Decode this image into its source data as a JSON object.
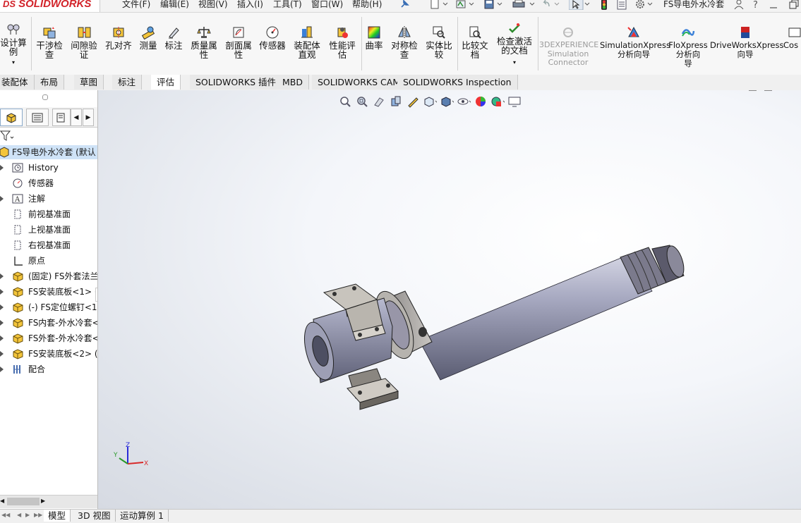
{
  "app": {
    "logo_prefix": "DS",
    "logo_text": "SOLIDWORKS",
    "doc_title": "FS导电外水冷套"
  },
  "menu": {
    "items": [
      "文件(F)",
      "编辑(E)",
      "视图(V)",
      "插入(I)",
      "工具(T)",
      "窗口(W)",
      "帮助(H)"
    ]
  },
  "command_manager": {
    "items": [
      {
        "label1": "设计算",
        "label2": "例"
      },
      {
        "label1": "干涉检",
        "label2": "查"
      },
      {
        "label1": "间隙验",
        "label2": "证"
      },
      {
        "label1": "孔对齐",
        "label2": ""
      },
      {
        "label1": "测量",
        "label2": ""
      },
      {
        "label1": "标注",
        "label2": ""
      },
      {
        "label1": "质量属",
        "label2": "性"
      },
      {
        "label1": "剖面属",
        "label2": "性"
      },
      {
        "label1": "传感器",
        "label2": ""
      },
      {
        "label1": "装配体",
        "label2": "直观"
      },
      {
        "label1": "性能评",
        "label2": "估"
      },
      {
        "label1": "曲率",
        "label2": ""
      },
      {
        "label1": "对称检",
        "label2": "查"
      },
      {
        "label1": "实体比",
        "label2": "较"
      },
      {
        "label1": "比较文",
        "label2": "档"
      },
      {
        "label1": "检查激活",
        "label2": "的文档"
      }
    ],
    "dim_item": {
      "label1": "3DEXPERIENCE",
      "label2": "Simulation",
      "label3": "Connector"
    },
    "addins": [
      {
        "label1": "SimulationXpress",
        "label2": "分析向导",
        "label3": ""
      },
      {
        "label1": "FloXpress",
        "label2": "分析向",
        "label3": "导"
      },
      {
        "label1": "DriveWorksXpress",
        "label2": "向导",
        "label3": ""
      },
      {
        "label1": "Cos",
        "label2": "",
        "label3": ""
      }
    ]
  },
  "tabs": [
    "装配体",
    "布局",
    "草图",
    "标注",
    "评估",
    "SOLIDWORKS 插件",
    "MBD",
    "SOLIDWORKS CAM",
    "SOLIDWORKS Inspection"
  ],
  "active_tab": "评估",
  "feature_tree": {
    "root": "FS导电外水冷套  (默认",
    "items": [
      {
        "label": "History",
        "icon": "history-icon",
        "expandable": true
      },
      {
        "label": "传感器",
        "icon": "sensor-icon",
        "expandable": false
      },
      {
        "label": "注解",
        "icon": "annotation-icon",
        "expandable": true
      },
      {
        "label": "前视基准面",
        "icon": "plane-icon",
        "expandable": false
      },
      {
        "label": "上视基准面",
        "icon": "plane-icon",
        "expandable": false
      },
      {
        "label": "右视基准面",
        "icon": "plane-icon",
        "expandable": false
      },
      {
        "label": "原点",
        "icon": "origin-icon",
        "expandable": false
      },
      {
        "label": "(固定) FS外套法兰",
        "icon": "part-icon",
        "expandable": true
      },
      {
        "label": "FS安装底板<1> (",
        "icon": "part-icon",
        "expandable": true
      },
      {
        "label": "(-) FS定位螺钉<1",
        "icon": "part-icon",
        "expandable": true
      },
      {
        "label": "FS内套-外水冷套<",
        "icon": "part-icon",
        "expandable": true
      },
      {
        "label": "FS外套-外水冷套<",
        "icon": "part-icon",
        "expandable": true
      },
      {
        "label": "FS安装底板<2> (",
        "icon": "part-icon",
        "expandable": true
      },
      {
        "label": "配合",
        "icon": "mates-icon",
        "expandable": true
      }
    ]
  },
  "bottom_tabs": [
    "模型",
    "3D 视图",
    "运动算例 1"
  ],
  "active_bottom_tab": "模型",
  "triad": {
    "x": "X",
    "y": "Y",
    "z": "Z"
  },
  "colors": {
    "brand": "#d2232a",
    "tree_selected": "#cfe3f7",
    "part_yellow": "#e8b830"
  }
}
